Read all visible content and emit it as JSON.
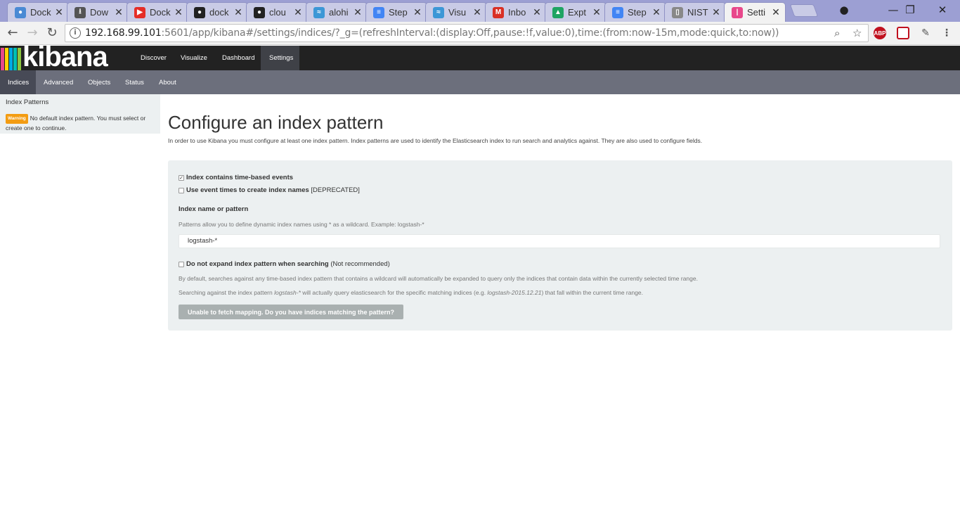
{
  "browser": {
    "tabs": [
      {
        "title": "Dock",
        "fav_color": "#4a8ad4",
        "fav_glyph": "●"
      },
      {
        "title": "Dow",
        "fav_color": "#555555",
        "fav_glyph": "⭳"
      },
      {
        "title": "Dock",
        "fav_color": "#e52d27",
        "fav_glyph": "▶"
      },
      {
        "title": "dock",
        "fav_color": "#222222",
        "fav_glyph": "●"
      },
      {
        "title": "clou",
        "fav_color": "#222222",
        "fav_glyph": "●"
      },
      {
        "title": "alohi",
        "fav_color": "#3c97d6",
        "fav_glyph": "≈"
      },
      {
        "title": "Step",
        "fav_color": "#4285f4",
        "fav_glyph": "≡"
      },
      {
        "title": "Visu",
        "fav_color": "#3c97d6",
        "fav_glyph": "≈"
      },
      {
        "title": "Inbo",
        "fav_color": "#d93025",
        "fav_glyph": "M"
      },
      {
        "title": "Expt",
        "fav_color": "#1fa463",
        "fav_glyph": "▲"
      },
      {
        "title": "Step",
        "fav_color": "#4285f4",
        "fav_glyph": "≡"
      },
      {
        "title": "NIST",
        "fav_color": "#888888",
        "fav_glyph": "▯"
      },
      {
        "title": "Setti",
        "fav_color": "#e8488b",
        "fav_glyph": "|"
      }
    ],
    "close_glyph": "✕",
    "url_host": "192.168.99.101",
    "url_rest": ":5601/app/kibana#/settings/indices/?_g=(refreshInterval:(display:Off,pause:!f,value:0),time:(from:now-15m,mode:quick,to:now))",
    "abp_label": "ABP"
  },
  "kibana": {
    "logo_text": "kibana",
    "logo_colors": [
      "#e8488b",
      "#ffd400",
      "#00a9e5",
      "#00bfb3",
      "#8cc63f"
    ],
    "nav": [
      "Discover",
      "Visualize",
      "Dashboard",
      "Settings"
    ],
    "subnav": [
      "Indices",
      "Advanced",
      "Objects",
      "Status",
      "About"
    ]
  },
  "sidebar": {
    "title": "Index Patterns",
    "warning_badge": "Warning",
    "warning_text": "No default index pattern. You must select or create one to continue."
  },
  "main": {
    "title": "Configure an index pattern",
    "intro": "In order to use Kibana you must configure at least one index pattern. Index patterns are used to identify the Elasticsearch index to run search and analytics against. They are also used to configure fields.",
    "cb_time_based": "Index contains time-based events",
    "cb_event_times": "Use event times to create index names",
    "cb_event_times_suffix": "[DEPRECATED]",
    "index_label": "Index name or pattern",
    "index_help": "Patterns allow you to define dynamic index names using * as a wildcard. Example: logstash-*",
    "index_value": "logstash-*",
    "cb_no_expand": "Do not expand index pattern when searching",
    "cb_no_expand_suffix": "(Not recommended)",
    "expand_help1": "By default, searches against any time-based index pattern that contains a wildcard will automatically be expanded to query only the indices that contain data within the currently selected time range.",
    "expand_help2_a": "Searching against the index pattern ",
    "expand_help2_b": "logstash-*",
    "expand_help2_c": " will actually query elasticsearch for the specific matching indices (e.g. ",
    "expand_help2_d": "logstash-2015.12.21",
    "expand_help2_e": ") that fall within the current time range.",
    "button": "Unable to fetch mapping. Do you have indices matching the pattern?"
  }
}
